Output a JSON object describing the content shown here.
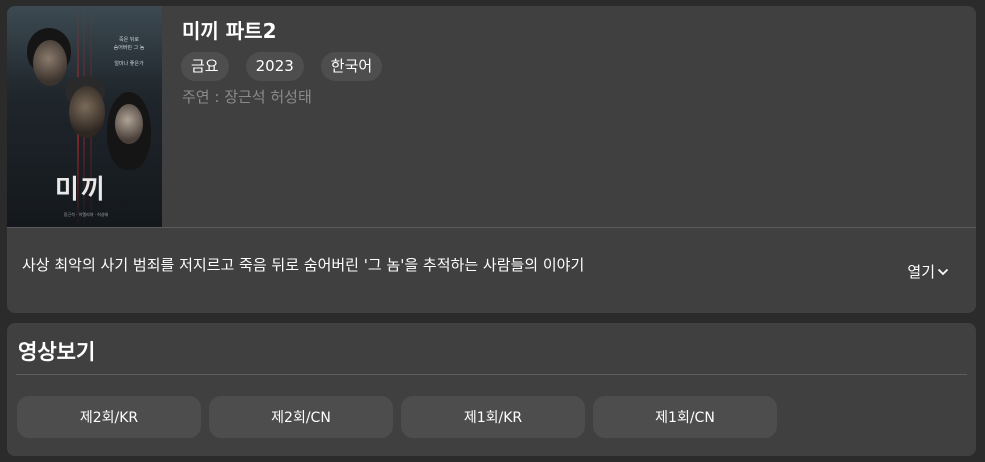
{
  "show": {
    "title": "미끼 파트2",
    "tags": [
      "금요",
      "2023",
      "한국어"
    ],
    "cast": "주연 : 장근석 허성태",
    "summary": "사상 최악의 사기 범죄를 저지르고 죽음 뒤로 숨어버린 '그 놈'을 추적하는 사람들의 이야기",
    "expand_label": "열기",
    "poster": {
      "title_text": "미끼",
      "tagline_lines": [
        "죽은 뒤로",
        "숨어버린 그 놈",
        "",
        "얼마나 좋은가"
      ],
      "credits_text": "장근석 · 이엘리야 · 허성태"
    }
  },
  "videos": {
    "heading": "영상보기",
    "episodes": [
      {
        "label": "제2회/KR"
      },
      {
        "label": "제2회/CN"
      },
      {
        "label": "제1회/KR"
      },
      {
        "label": "제1회/CN"
      }
    ]
  },
  "colors": {
    "background": "#2b2b2b",
    "card": "#404040",
    "chip": "#4e4e4e",
    "muted_text": "#8a8a8a"
  }
}
